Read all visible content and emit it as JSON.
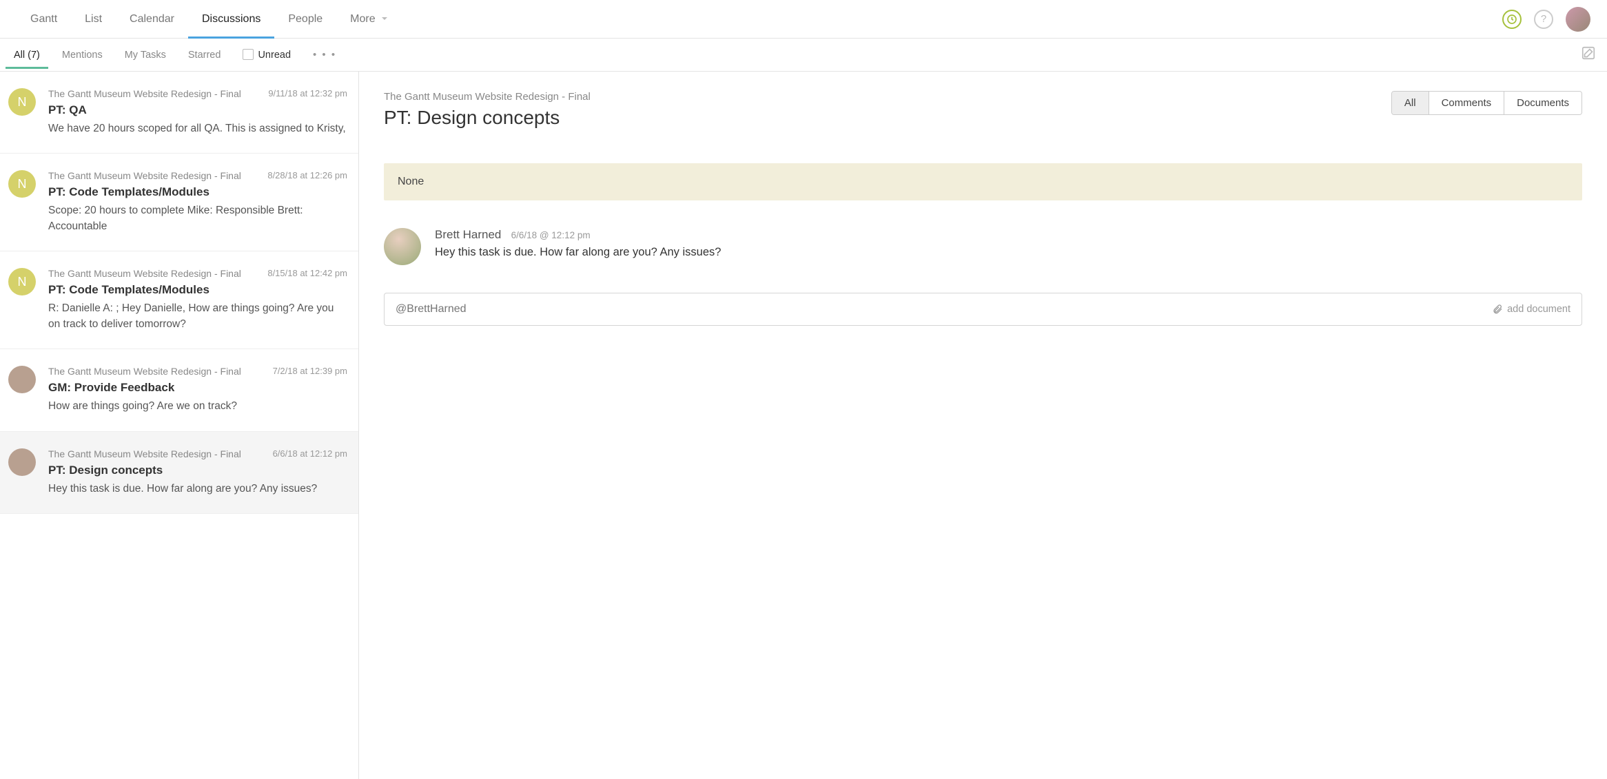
{
  "topnav": {
    "tabs": [
      "Gantt",
      "List",
      "Calendar",
      "Discussions",
      "People",
      "More"
    ],
    "active_index": 3
  },
  "subnav": {
    "tabs": [
      "All (7)",
      "Mentions",
      "My Tasks",
      "Starred"
    ],
    "active_index": 0,
    "unread_label": "Unread"
  },
  "threads": [
    {
      "avatar_type": "letter",
      "avatar_letter": "N",
      "project": "The Gantt Museum Website Redesign - Final",
      "date": "9/11/18 at 12:32 pm",
      "title": "PT: QA",
      "preview": "We have 20 hours scoped for all QA. This is assigned to Kristy,"
    },
    {
      "avatar_type": "letter",
      "avatar_letter": "N",
      "project": "The Gantt Museum Website Redesign - Final",
      "date": "8/28/18 at 12:26 pm",
      "title": "PT: Code Templates/Modules",
      "preview": "Scope: 20 hours to complete Mike: Responsible Brett: Accountable"
    },
    {
      "avatar_type": "letter",
      "avatar_letter": "N",
      "project": "The Gantt Museum Website Redesign - Final",
      "date": "8/15/18 at 12:42 pm",
      "title": "PT: Code Templates/Modules",
      "preview": "R: Danielle A: ; Hey Danielle, How are things going? Are you on track to deliver tomorrow?"
    },
    {
      "avatar_type": "photo",
      "avatar_letter": "",
      "project": "The Gantt Museum Website Redesign - Final",
      "date": "7/2/18 at 12:39 pm",
      "title": "GM: Provide Feedback",
      "preview": "How are things going? Are we on track?"
    },
    {
      "avatar_type": "photo",
      "avatar_letter": "",
      "project": "The Gantt Museum Website Redesign - Final",
      "date": "6/6/18 at 12:12 pm",
      "title": "PT: Design concepts",
      "preview": "Hey this task is due. How far along are you? Any issues?"
    }
  ],
  "selected_thread_index": 4,
  "detail": {
    "project": "The Gantt Museum Website Redesign - Final",
    "title": "PT: Design concepts",
    "pills": [
      "All",
      "Comments",
      "Documents"
    ],
    "pill_active_index": 0,
    "none_bar": "None",
    "comment": {
      "author": "Brett Harned",
      "meta": "6/6/18 @ 12:12 pm",
      "body": "Hey this task is due. How far along are you? Any issues?"
    },
    "reply_placeholder": "@BrettHarned",
    "add_document_label": "add document"
  }
}
